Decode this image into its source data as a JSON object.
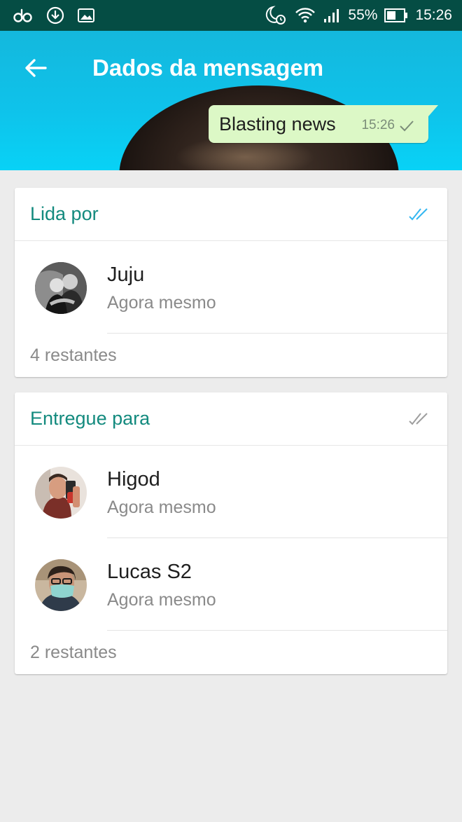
{
  "status_bar": {
    "battery_percent": "55%",
    "time": "15:26",
    "icons": [
      "oo-icon",
      "download-icon",
      "image-icon",
      "night-alarm-icon",
      "wifi-icon",
      "signal-icon",
      "battery-icon"
    ]
  },
  "header": {
    "title": "Dados da mensagem",
    "message": {
      "text": "Blasting news",
      "time": "15:26"
    }
  },
  "read_section": {
    "title": "Lida por",
    "status_icon": "double-check-blue-icon",
    "contacts": [
      {
        "name": "Juju",
        "when": "Agora mesmo"
      }
    ],
    "remaining": "4 restantes"
  },
  "delivered_section": {
    "title": "Entregue para",
    "status_icon": "double-check-grey-icon",
    "contacts": [
      {
        "name": "Higod",
        "when": "Agora mesmo"
      },
      {
        "name": "Lucas S2",
        "when": "Agora mesmo"
      }
    ],
    "remaining": "2 restantes"
  },
  "colors": {
    "status_bar": "#054d44",
    "header": "#0fc2ea",
    "accent": "#138a7e",
    "read_check": "#34b7f1",
    "bubble": "#dcf8c6"
  }
}
